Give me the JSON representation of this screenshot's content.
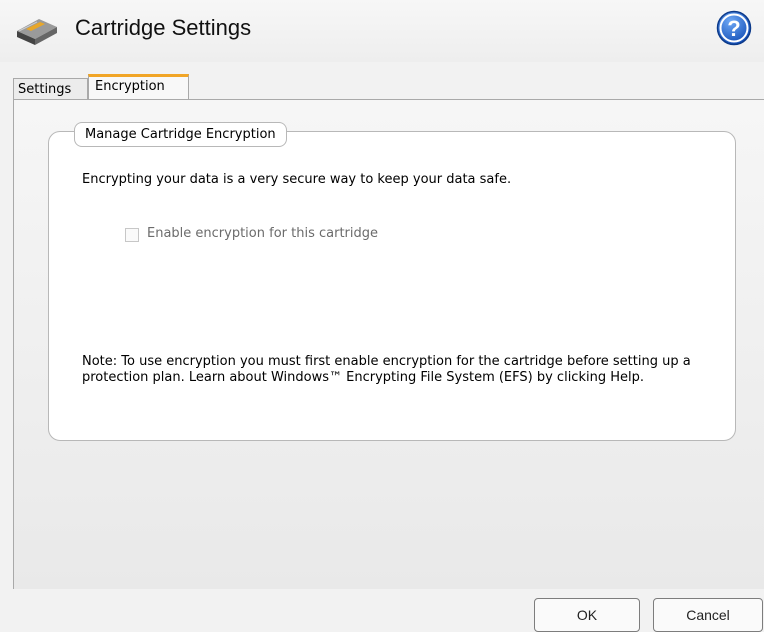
{
  "window": {
    "title": "Cartridge Settings",
    "icon": "cartridge-drive-icon",
    "help_icon": "question-mark-icon"
  },
  "tabs": [
    {
      "label": "Settings",
      "active": false
    },
    {
      "label": "Encryption",
      "active": true
    }
  ],
  "encryption": {
    "group_title": "Manage Cartridge Encryption",
    "intro": "Encrypting your data is a very secure way to keep your data safe.",
    "checkbox_label": "Enable encryption for this cartridge",
    "checkbox_checked": false,
    "checkbox_enabled": false,
    "note": "Note: To use encryption you must first enable encryption for the cartridge before setting up a protection plan. Learn about Windows™ Encrypting File System (EFS) by clicking Help."
  },
  "buttons": {
    "ok": "OK",
    "cancel": "Cancel"
  },
  "colors": {
    "active_tab_accent": "#f1a526",
    "help_button": "#1f66c9"
  }
}
